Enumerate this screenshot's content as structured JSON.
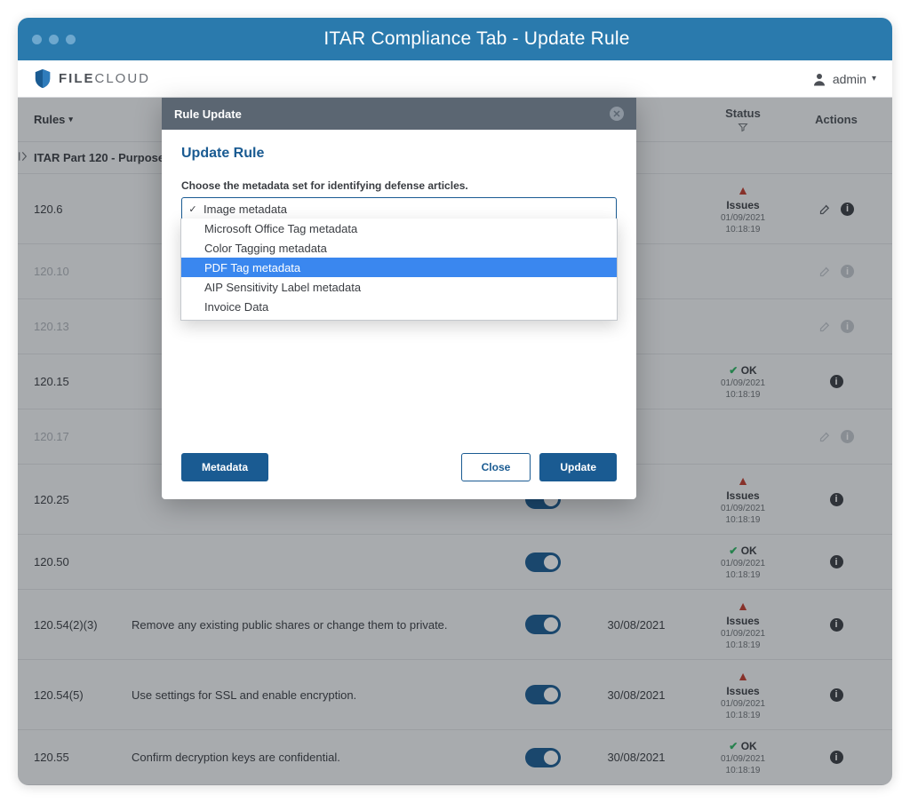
{
  "window_title": "ITAR Compliance Tab - Update Rule",
  "brand": {
    "prefix": "FILE",
    "suffix": "CLOUD"
  },
  "user": {
    "label": "admin"
  },
  "columns": {
    "rules": "Rules",
    "status": "Status",
    "actions": "Actions"
  },
  "section": "ITAR Part 120 - Purpose and",
  "rows": [
    {
      "id": "120.6",
      "desc": "",
      "toggle": true,
      "date": "",
      "status": {
        "type": "issues",
        "label": "Issues",
        "date": "01/09/2021",
        "time": "10:18:19"
      },
      "edit": true,
      "muted": false
    },
    {
      "id": "120.10",
      "desc": "",
      "toggle": false,
      "date": "",
      "status": null,
      "edit": true,
      "muted": true
    },
    {
      "id": "120.13",
      "desc": "",
      "toggle": false,
      "date": "",
      "status": null,
      "edit": true,
      "muted": true
    },
    {
      "id": "120.15",
      "desc": "",
      "toggle": true,
      "date": "",
      "status": {
        "type": "ok",
        "label": "OK",
        "date": "01/09/2021",
        "time": "10:18:19"
      },
      "edit": false,
      "muted": false
    },
    {
      "id": "120.17",
      "desc": "",
      "toggle": false,
      "date": "",
      "status": null,
      "edit": true,
      "muted": true
    },
    {
      "id": "120.25",
      "desc": "",
      "toggle": true,
      "date": "",
      "status": {
        "type": "issues",
        "label": "Issues",
        "date": "01/09/2021",
        "time": "10:18:19"
      },
      "edit": false,
      "muted": false
    },
    {
      "id": "120.50",
      "desc": "",
      "toggle": true,
      "date": "",
      "status": {
        "type": "ok",
        "label": "OK",
        "date": "01/09/2021",
        "time": "10:18:19"
      },
      "edit": false,
      "muted": false
    },
    {
      "id": "120.54(2)(3)",
      "desc": "Remove any existing public shares or change them to private.",
      "toggle": true,
      "date": "30/08/2021",
      "status": {
        "type": "issues",
        "label": "Issues",
        "date": "01/09/2021",
        "time": "10:18:19"
      },
      "edit": false,
      "muted": false
    },
    {
      "id": "120.54(5)",
      "desc": "Use settings for SSL and enable encryption.",
      "toggle": true,
      "date": "30/08/2021",
      "status": {
        "type": "issues",
        "label": "Issues",
        "date": "01/09/2021",
        "time": "10:18:19"
      },
      "edit": false,
      "muted": false
    },
    {
      "id": "120.55",
      "desc": "Confirm decryption keys are confidential.",
      "toggle": true,
      "date": "30/08/2021",
      "status": {
        "type": "ok",
        "label": "OK",
        "date": "01/09/2021",
        "time": "10:18:19"
      },
      "edit": false,
      "muted": false
    }
  ],
  "modal": {
    "header": "Rule Update",
    "title": "Update Rule",
    "prompt": "Choose the metadata set for identifying defense articles.",
    "selected": "Image metadata",
    "options": [
      "Microsoft Office Tag metadata",
      "Color Tagging metadata",
      "PDF Tag metadata",
      "AIP Sensitivity Label metadata",
      "Invoice Data"
    ],
    "highlight_index": 2,
    "buttons": {
      "metadata": "Metadata",
      "close": "Close",
      "update": "Update"
    }
  }
}
